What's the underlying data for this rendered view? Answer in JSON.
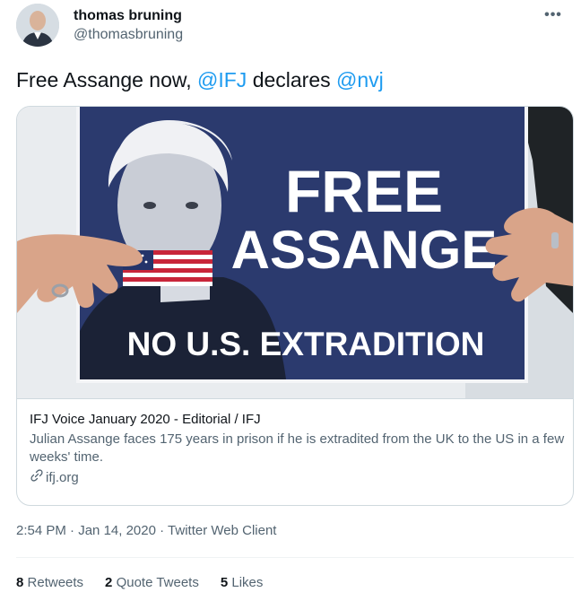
{
  "user": {
    "display_name": "thomas bruning",
    "handle": "@thomasbruning"
  },
  "tweet": {
    "text_before": "Free Assange now, ",
    "mention_1": "@IFJ",
    "text_middle": " declares ",
    "mention_2": "@nvj"
  },
  "card": {
    "image": {
      "sign_line_1": "FREE",
      "sign_line_2": "ASSANGE",
      "sign_line_3": "NO U.S. EXTRADITION"
    },
    "title": "IFJ Voice January 2020 - Editorial / IFJ",
    "description": "Julian Assange faces 175 years in prison if he is extradited from the UK to the US in a few weeks' time.",
    "domain": "ifj.org"
  },
  "meta": {
    "time": "2:54 PM",
    "date": "Jan 14, 2020",
    "client": "Twitter Web Client",
    "separator": " · "
  },
  "stats": {
    "retweets_count": "8",
    "retweets_label": "Retweets",
    "quotes_count": "2",
    "quotes_label": "Quote Tweets",
    "likes_count": "5",
    "likes_label": "Likes"
  },
  "colors": {
    "accent": "#1d9bf0",
    "sign_blue": "#2b3a6e",
    "text_secondary": "#536471"
  },
  "icons": {
    "more": "more-options-icon",
    "link": "link-icon"
  }
}
